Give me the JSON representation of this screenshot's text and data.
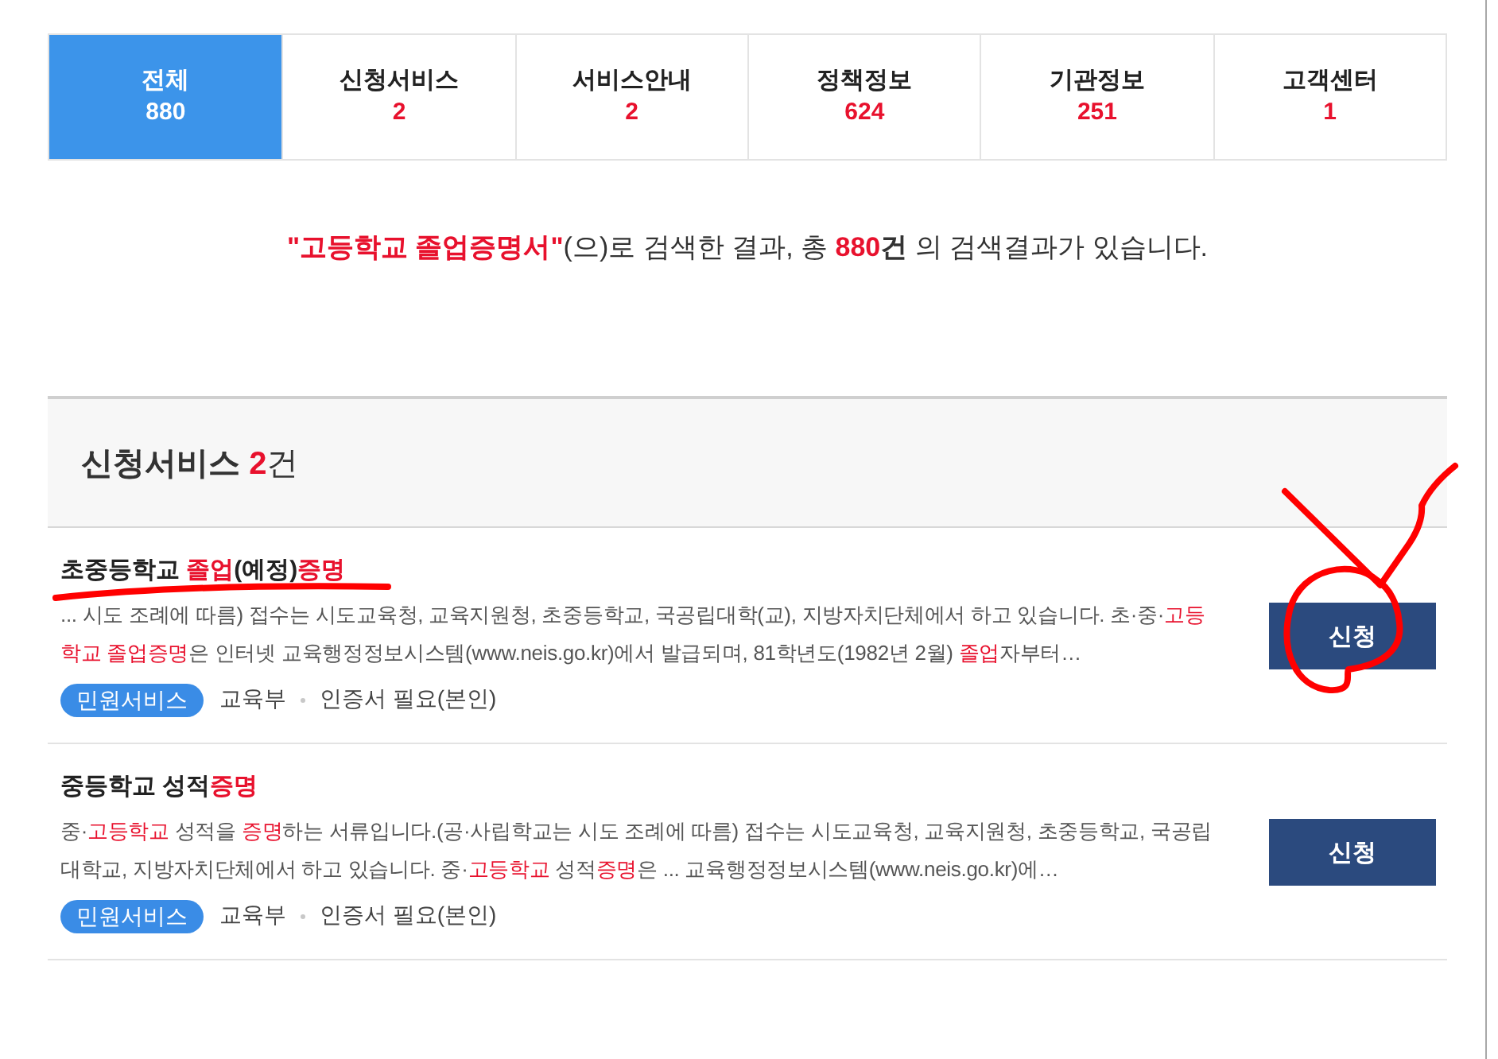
{
  "tabs": [
    {
      "label": "전체",
      "count": "880",
      "selected": true
    },
    {
      "label": "신청서비스",
      "count": "2",
      "selected": false
    },
    {
      "label": "서비스안내",
      "count": "2",
      "selected": false
    },
    {
      "label": "정책정보",
      "count": "624",
      "selected": false
    },
    {
      "label": "기관정보",
      "count": "251",
      "selected": false
    },
    {
      "label": "고객센터",
      "count": "1",
      "selected": false
    }
  ],
  "summary": [
    {
      "text": "**\"고등학교 졸업증명서\"**",
      "highlight": true
    },
    {
      "text": "(으)로 검색한 결과, 총 ",
      "highlight": false
    },
    {
      "text": "**880**",
      "highlight": true
    },
    {
      "text": "**건** 의 검색결과가 있습니다.",
      "highlight": false
    }
  ],
  "section": {
    "title": "신청서비스",
    "count": "2",
    "unit": "건"
  },
  "results": [
    {
      "title": [
        {
          "text": "초중등학교 ",
          "highlight": false
        },
        {
          "text": "졸업",
          "highlight": true
        },
        {
          "text": "(예정)",
          "highlight": false
        },
        {
          "text": "증명",
          "highlight": true
        }
      ],
      "description": [
        {
          "text": "... 시도 조례에 따름) 접수는 시도교육청, 교육지원청, 초중등학교, 국공립대학(교), 지방자치단체에서 하고 있습니다. 초·중·",
          "highlight": false
        },
        {
          "text": "고등학교",
          "highlight": true
        },
        {
          "text": " 졸업증명",
          "highlight": true
        },
        {
          "text": "은 인터넷 교육행정정보시스템(www.neis.go.kr)에서 발급되며, 81학년도(1982년 2월) ",
          "highlight": false
        },
        {
          "text": "졸업",
          "highlight": true
        },
        {
          "text": "자부터…",
          "highlight": false
        }
      ],
      "category": "민원서비스",
      "agency": "교육부",
      "requirement": "인증서 필요(본인)",
      "button": "신청"
    },
    {
      "title": [
        {
          "text": "중등학교 성적",
          "highlight": false
        },
        {
          "text": "증명",
          "highlight": true
        }
      ],
      "description": [
        {
          "text": "중·",
          "highlight": false
        },
        {
          "text": "고등학교",
          "highlight": true
        },
        {
          "text": " 성적을 ",
          "highlight": false
        },
        {
          "text": "증명",
          "highlight": true
        },
        {
          "text": "하는 서류입니다.(공·사립학교는 시도 조례에 따름) 접수는 시도교육청, 교육지원청, 초중등학교, 국공립대학교, 지방자치단체에서 하고 있습니다. 중·",
          "highlight": false
        },
        {
          "text": "고등학교",
          "highlight": true
        },
        {
          "text": " 성적",
          "highlight": false
        },
        {
          "text": "증명",
          "highlight": true
        },
        {
          "text": "은 ... 교육행정정보시스템(www.neis.go.kr)에…",
          "highlight": false
        }
      ],
      "category": "민원서비스",
      "agency": "교육부",
      "requirement": "인증서 필요(본인)",
      "button": "신청"
    }
  ],
  "annotations": [
    {
      "kind": "underline"
    },
    {
      "kind": "circle"
    },
    {
      "kind": "check"
    }
  ]
}
